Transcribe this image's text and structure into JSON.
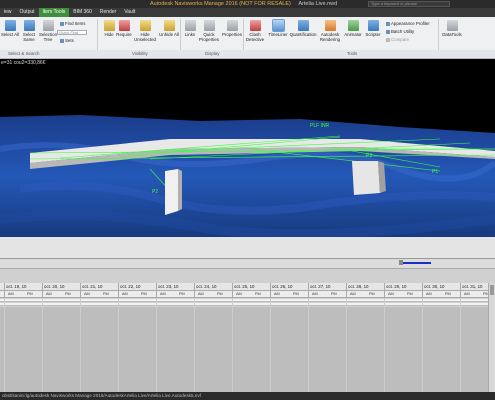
{
  "app": {
    "title_app": "Autodesk Navisworks Manage 2016 (NOT FOR RESALE)",
    "title_file": "Artelia Live.nwd",
    "search_placeholder": "Type a keyword or phrase"
  },
  "tabs": [
    "iew",
    "Output",
    "Item Tools",
    "BIM 360",
    "Render",
    "Vault"
  ],
  "active_tab": "Item Tools",
  "ribbon": {
    "select_all": "Select All",
    "select_same": "Select Same",
    "selection_tree": "Selection Tree",
    "find_items": "Find Items",
    "quick_find": "Quick Find",
    "sets": "Sets",
    "hide": "Hide",
    "require": "Require",
    "hide_unselected": "Hide Unselected",
    "unhide_all": "Unhide All",
    "links": "Links",
    "quick_properties": "Quick Properties",
    "properties": "Properties",
    "clash_detective": "Clash Detective",
    "timeliner": "TimeLiner",
    "quantification": "Quantification",
    "autodesk_rendering": "Autodesk Rendering",
    "animator": "Animator",
    "scripter": "Scripter",
    "appearance_profiler": "Appearance Profiler",
    "batch_utility": "Batch Utility",
    "compare": "Compare",
    "datatools": "DataTools",
    "groups": {
      "select_search": "Select & Search",
      "visibility": "Visibility",
      "display": "Display",
      "tools": "Tools"
    }
  },
  "viewport": {
    "coords": "e=31 cou2=330,86€",
    "labels": [
      "PLF INR",
      "P1",
      "P2",
      "P3"
    ]
  },
  "timeliner": {
    "dates": [
      "oct. 19, 10",
      "oct. 20, 10",
      "oct. 21, 10",
      "oct. 22, 10",
      "oct. 23, 10",
      "oct. 24, 10",
      "oct. 25, 10",
      "oct. 26, 10",
      "oct. 27, 10",
      "oct. 28, 10",
      "oct. 29, 10",
      "oct. 30, 10",
      "oct. 31, 10"
    ],
    "am": "AM",
    "pm": "PM"
  },
  "status": {
    "path": "obsEkanini:lg/autodesk Navisworks Manage 2016/AutodeskArtelia Live/Artelia Live.Autodesk5.nvf"
  },
  "colors": {
    "active_tab": "#3f8f3f",
    "slider": "#1a2ec8",
    "model_lines": "#3cff3c"
  }
}
